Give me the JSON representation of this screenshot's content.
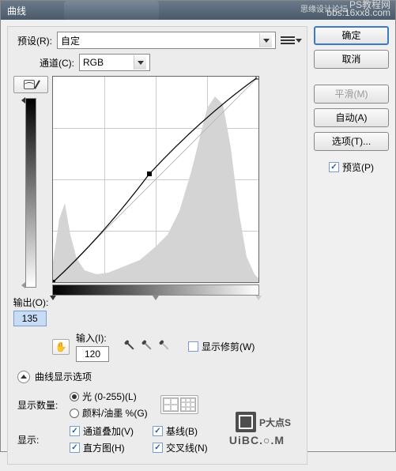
{
  "title": "曲线",
  "watermark": {
    "line1": "PS教程网",
    "line2": "bbs.16xx8.com",
    "forum": "思缘设计论坛"
  },
  "preset": {
    "label": "预设(R):",
    "value": "自定"
  },
  "channel": {
    "label": "通道(C):",
    "value": "RGB"
  },
  "output": {
    "label": "输出(O):",
    "value": "135"
  },
  "input": {
    "label": "输入(I):",
    "value": "120"
  },
  "show_clipping": "显示修剪(W)",
  "section_header": "曲线显示选项",
  "display_amount": {
    "label": "显示数量:",
    "light": "光 (0-255)(L)",
    "pigment": "颜料/油墨 %(G)"
  },
  "show": {
    "label": "显示:",
    "overlay": "通道叠加(V)",
    "baseline": "基线(B)",
    "histogram": "直方图(H)",
    "intersection": "交叉线(N)"
  },
  "buttons": {
    "ok": "确定",
    "cancel": "取消",
    "smooth": "平滑(M)",
    "auto": "自动(A)",
    "options": "选项(T)...",
    "preview": "预览(P)"
  },
  "logo": {
    "text": "P大点S",
    "url": "UiBC.○.M"
  },
  "chart_data": {
    "type": "curve",
    "xlabel": "输入",
    "ylabel": "输出",
    "xlim": [
      0,
      255
    ],
    "ylim": [
      0,
      255
    ],
    "points": [
      {
        "x": 0,
        "y": 0
      },
      {
        "x": 120,
        "y": 135
      },
      {
        "x": 255,
        "y": 255
      }
    ],
    "histogram_peaks": "dark-heavy with large peak near 180-220"
  }
}
